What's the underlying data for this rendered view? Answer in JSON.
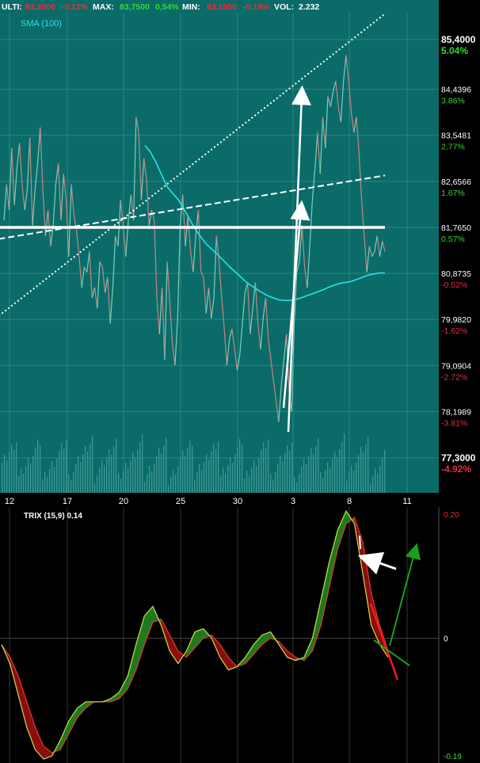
{
  "header": {
    "last_label": "ULTI:",
    "last_value": "83,2000",
    "last_change": "-0,12%",
    "max_label": "MAX:",
    "max_value": "83,7500",
    "max_change": "0,54%",
    "min_label": "MIN:",
    "min_value": "83,1500",
    "min_change": "-0,18%",
    "vol_label": "VOL:",
    "vol_value": "2.232"
  },
  "colors": {
    "panel_bg": "#0a6b69",
    "grid": "#2f8683",
    "price_line": "#c78585",
    "price_line_up": "#7fd0b8",
    "sma": "#2ee0e6",
    "up_text": "#34d63a",
    "down_text": "#e0333a",
    "trix_bg": "#000000",
    "trix_green": "#1e7a1e",
    "trix_red": "#8a0d10",
    "trix_line_yellow": "#c8e04a",
    "trix_signal": "#e23a2a",
    "annotation_white": "#ffffff",
    "annotation_green": "#1aa01a",
    "annotation_red": "#ff1a1a"
  },
  "chart_data": [
    {
      "type": "line",
      "series": [
        {
          "name": "SMA (100)",
          "role": "sma"
        }
      ],
      "ylim": [
        77.3,
        85.4
      ],
      "price_axis": [
        {
          "price": "85,4000",
          "pct": "5.04%",
          "dir": "up",
          "v": 85.4
        },
        {
          "price": "84,4396",
          "pct": "3.86%",
          "dir": "up",
          "v": 84.4396
        },
        {
          "price": "83,5481",
          "pct": "2.77%",
          "dir": "up",
          "v": 83.5481
        },
        {
          "price": "82,6566",
          "pct": "1.67%",
          "dir": "up",
          "v": 82.6566
        },
        {
          "price": "81,7650",
          "pct": "0.57%",
          "dir": "up",
          "v": 81.765
        },
        {
          "price": "80,8735",
          "pct": "-0.52%",
          "dir": "down",
          "v": 80.8735
        },
        {
          "price": "79,9820",
          "pct": "-1.62%",
          "dir": "down",
          "v": 79.982
        },
        {
          "price": "79,0904",
          "pct": "-2.72%",
          "dir": "down",
          "v": 79.0904
        },
        {
          "price": "78,1989",
          "pct": "-3.81%",
          "dir": "down",
          "v": 78.1989
        },
        {
          "price": "77,3000",
          "pct": "-4.92%",
          "dir": "down",
          "v": 77.3
        }
      ],
      "x_ticks": [
        "12",
        "17",
        "20",
        "25",
        "30",
        "3",
        "8",
        "11"
      ],
      "price": [
        81.9,
        82.6,
        82.1,
        83.3,
        82.2,
        82.9,
        83.4,
        82.6,
        82.1,
        82.5,
        83.5,
        81.8,
        82.5,
        83.0,
        83.7,
        82.5,
        81.6,
        82.1,
        81.4,
        81.8,
        82.6,
        83.0,
        81.9,
        82.8,
        82.3,
        81.2,
        82.6,
        82.0,
        81.7,
        81.2,
        80.6,
        81.0,
        80.9,
        81.3,
        80.4,
        80.6,
        80.2,
        81.1,
        81.0,
        80.5,
        80.8,
        79.9,
        80.6,
        81.6,
        81.4,
        82.3,
        81.8,
        81.2,
        81.9,
        82.4,
        81.9,
        83.9,
        83.6,
        82.3,
        83.1,
        82.7,
        81.8,
        82.1,
        81.9,
        80.4,
        79.7,
        80.6,
        79.2,
        81.1,
        80.3,
        79.5,
        79.1,
        80.0,
        81.8,
        82.4,
        81.4,
        82.0,
        81.3,
        80.9,
        81.6,
        82.1,
        80.9,
        80.8,
        80.1,
        80.6,
        80.0,
        80.4,
        81.6,
        81.1,
        80.4,
        79.8,
        79.1,
        79.6,
        79.8,
        79.4,
        79.0,
        79.3,
        79.9,
        80.5,
        80.7,
        79.7,
        80.2,
        80.7,
        79.9,
        79.4,
        80.0,
        80.4,
        79.6,
        79.2,
        78.8,
        78.4,
        78.0,
        78.7,
        79.2,
        79.7,
        78.6,
        78.2,
        79.9,
        80.9,
        81.1,
        81.8,
        81.0,
        80.6,
        81.4,
        82.3,
        82.9,
        83.6,
        82.8,
        83.9,
        83.3,
        84.3,
        84.1,
        84.4,
        84.6,
        84.1,
        83.8,
        84.6,
        85.1,
        84.6,
        84.0,
        83.6,
        83.9,
        83.2,
        82.3,
        81.6,
        80.9,
        81.4,
        81.2,
        81.3,
        81.6,
        81.2,
        81.5,
        81.3
      ],
      "sma": [
        83.35,
        83.22,
        83.02,
        82.78,
        82.55,
        82.42,
        82.3,
        82.12,
        81.92,
        81.73,
        81.58,
        81.44,
        81.34,
        81.24,
        81.13,
        81.02,
        80.92,
        80.82,
        80.72,
        80.64,
        80.57,
        80.5,
        80.44,
        80.4,
        80.36,
        80.35,
        80.35,
        80.37,
        80.4,
        80.44,
        80.48,
        80.52,
        80.56,
        80.61,
        80.65,
        80.68,
        80.7,
        80.72,
        80.76,
        80.8,
        80.84,
        80.86,
        80.88,
        80.88
      ],
      "trend_lines": [
        {
          "style": "dotted",
          "p1": [
            -2,
            80.05
          ],
          "p2": [
            147,
            85.9
          ]
        },
        {
          "style": "dashed",
          "p1": [
            -2,
            81.54
          ],
          "p2": [
            147,
            82.77
          ]
        },
        {
          "style": "solid",
          "p1": [
            -2,
            81.765
          ],
          "p2": [
            147,
            81.765
          ]
        }
      ]
    },
    {
      "type": "line",
      "title": "TRIX (15,9) 0.14",
      "ylim": [
        -0.19,
        0.2
      ],
      "y_ticks": [
        "0.20",
        "0",
        "-0.19"
      ],
      "series": [
        {
          "name": "TRIX (15,9)",
          "role": "trix",
          "values": [
            -0.01,
            -0.04,
            -0.09,
            -0.14,
            -0.175,
            -0.19,
            -0.185,
            -0.16,
            -0.13,
            -0.11,
            -0.1,
            -0.1,
            -0.1,
            -0.095,
            -0.085,
            -0.06,
            -0.01,
            0.035,
            0.05,
            0.02,
            -0.02,
            -0.04,
            -0.02,
            0.01,
            0.015,
            0.0,
            -0.03,
            -0.05,
            -0.045,
            -0.03,
            -0.01,
            0.005,
            0.01,
            -0.01,
            -0.03,
            -0.035,
            -0.03,
            0.0,
            0.06,
            0.12,
            0.17,
            0.2,
            0.18,
            0.1,
            0.02,
            -0.01,
            -0.03
          ]
        },
        {
          "name": "Signal",
          "role": "signal",
          "values": [
            -0.01,
            -0.03,
            -0.06,
            -0.1,
            -0.14,
            -0.17,
            -0.18,
            -0.175,
            -0.15,
            -0.125,
            -0.11,
            -0.1,
            -0.1,
            -0.1,
            -0.095,
            -0.08,
            -0.05,
            -0.01,
            0.025,
            0.03,
            0.005,
            -0.02,
            -0.03,
            -0.015,
            0.0,
            0.005,
            -0.01,
            -0.03,
            -0.045,
            -0.04,
            -0.025,
            -0.01,
            0.0,
            -0.005,
            -0.02,
            -0.03,
            -0.035,
            -0.02,
            0.02,
            0.08,
            0.14,
            0.18,
            0.19,
            0.15,
            0.07,
            0.02,
            -0.02
          ]
        }
      ]
    }
  ]
}
